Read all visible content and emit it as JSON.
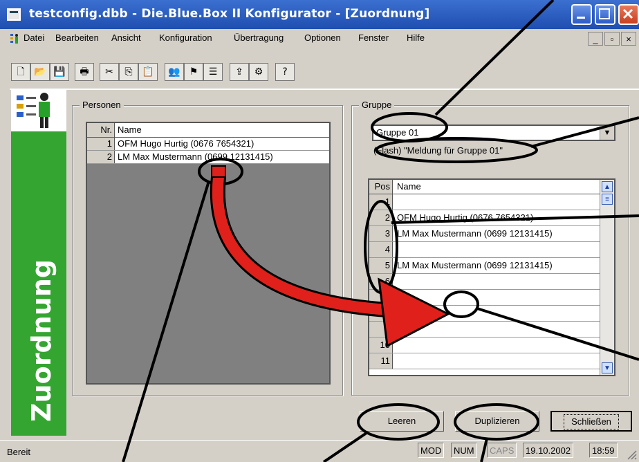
{
  "window": {
    "title": "testconfig.dbb - Die.Blue.Box II Konfigurator - [Zuordnung]"
  },
  "menu": [
    "Datei",
    "Bearbeiten",
    "Ansicht",
    "Konfiguration",
    "Übertragung",
    "Optionen",
    "Fenster",
    "Hilfe"
  ],
  "side_label": "Zuordnung",
  "personen": {
    "title": "Personen",
    "col_nr": "Nr.",
    "col_name": "Name",
    "rows": [
      {
        "nr": "1",
        "name": "OFM Hugo Hurtig (0676 7654321)"
      },
      {
        "nr": "2",
        "name": "LM Max Mustermann (0699 12131415)"
      }
    ]
  },
  "gruppe": {
    "title": "Gruppe",
    "selected": "Gruppe 01",
    "message": "(Flash) \"Meldung für Gruppe 01\"",
    "col_pos": "Pos",
    "col_name": "Name",
    "rows": [
      {
        "pos": "1",
        "name": ""
      },
      {
        "pos": "2",
        "name": "OFM Hugo Hurtig (0676 7654321)"
      },
      {
        "pos": "3",
        "name": "LM Max Mustermann (0699 12131415)"
      },
      {
        "pos": "4",
        "name": ""
      },
      {
        "pos": "5",
        "name": "LM Max Mustermann (0699 12131415)"
      },
      {
        "pos": "6",
        "name": ""
      },
      {
        "pos": "7",
        "name": ""
      },
      {
        "pos": "8",
        "name": ""
      },
      {
        "pos": "9",
        "name": ""
      },
      {
        "pos": "10",
        "name": ""
      },
      {
        "pos": "11",
        "name": ""
      }
    ]
  },
  "buttons": {
    "leeren": "Leeren",
    "duplizieren": "Duplizieren",
    "schliessen": "Schließen"
  },
  "status": {
    "text": "Bereit",
    "mod": "MOD",
    "num": "NUM",
    "caps": "CAPS",
    "date": "19.10.2002",
    "time": "18:59"
  },
  "colors": {
    "title_bar": "#1f4fb0",
    "side_panel": "#35a531",
    "arrow": "#e0201a"
  }
}
